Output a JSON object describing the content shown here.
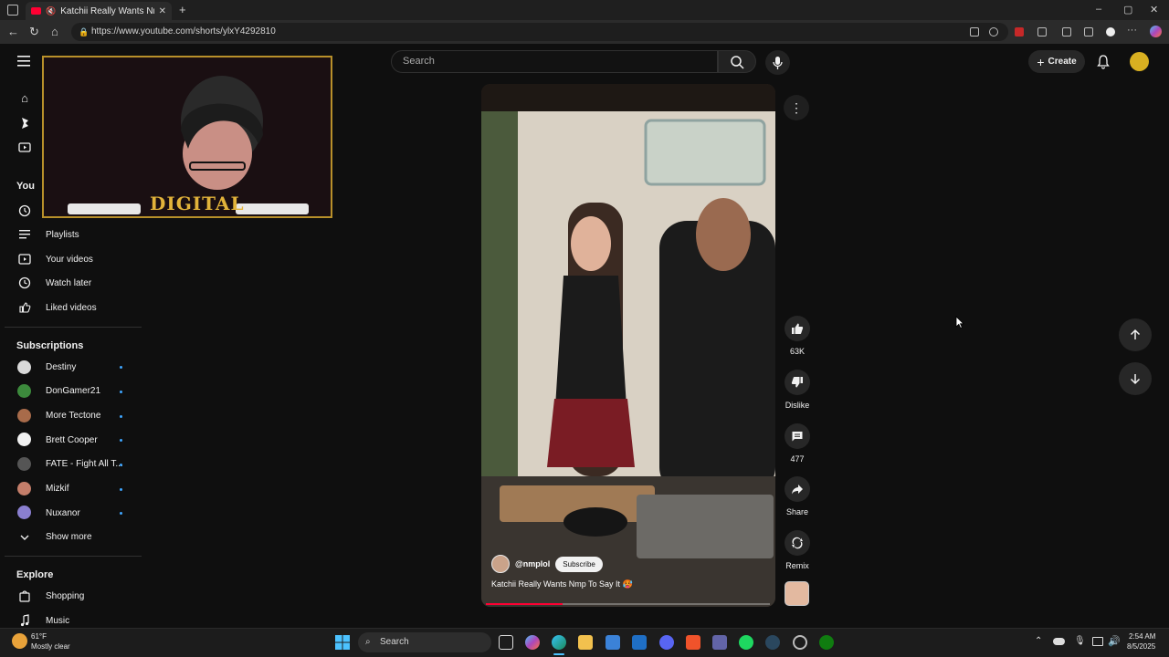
{
  "browser": {
    "tab_title": "Katchii Really Wants Nmp To",
    "url": "https://www.youtube.com/shorts/ylxY4292810"
  },
  "youtube": {
    "search_placeholder": "Search",
    "create_label": "Create",
    "sidebar": {
      "you_heading": "You",
      "you_items": [
        {
          "label": "Playlists",
          "icon": "playlists-icon"
        },
        {
          "label": "Your videos",
          "icon": "your-videos-icon"
        },
        {
          "label": "Watch later",
          "icon": "watch-later-icon"
        },
        {
          "label": "Liked videos",
          "icon": "liked-videos-icon"
        }
      ],
      "subscriptions_heading": "Subscriptions",
      "subscriptions": [
        {
          "label": "Destiny",
          "color": "#d9d9d9"
        },
        {
          "label": "DonGamer21",
          "color": "#3c8a3c"
        },
        {
          "label": "More Tectone",
          "color": "#a86b4a"
        },
        {
          "label": "Brett Cooper",
          "color": "#f1f1f1"
        },
        {
          "label": "FATE - Fight All T...",
          "color": "#555555"
        },
        {
          "label": "Mizkif",
          "color": "#c47e6a"
        },
        {
          "label": "Nuxanor",
          "color": "#8a7fd0"
        }
      ],
      "show_more": "Show more",
      "explore_heading": "Explore",
      "explore_items": [
        {
          "label": "Shopping",
          "icon": "shopping-bag-icon"
        },
        {
          "label": "Music",
          "icon": "music-note-icon"
        }
      ]
    },
    "short": {
      "handle": "@nmplol",
      "subscribe_label": "Subscribe",
      "title": "Katchii Really Wants Nmp To Say It 🥵",
      "progress": 0.27,
      "likes": "63K",
      "dislike_label": "Dislike",
      "comments": "477",
      "share_label": "Share",
      "remix_label": "Remix"
    },
    "webcam_overlay_text": "DIGITAL"
  },
  "taskbar": {
    "weather_temp": "61°F",
    "weather_desc": "Mostly clear",
    "search_label": "Search",
    "time": "2:54 AM",
    "date": "8/5/2025"
  }
}
